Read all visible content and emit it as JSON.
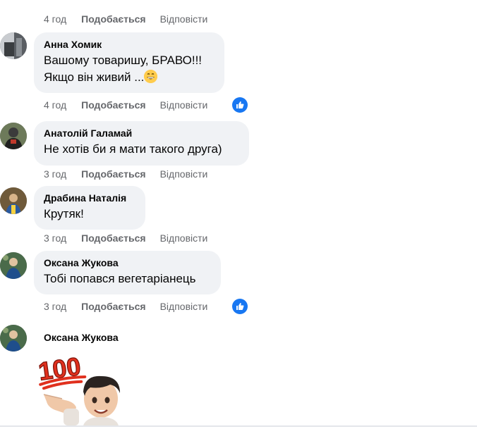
{
  "top_meta": {
    "time": "4 год",
    "like": "Подобається",
    "reply": "Відповісти"
  },
  "comments": [
    {
      "author": "Анна Хомик",
      "lines": [
        "Вашому товаришу, БРАВО!!!",
        "Якщо він живий ..."
      ],
      "emoji": "grinning-face-emoji",
      "time": "4 год",
      "like": "Подобається",
      "reply": "Відповісти",
      "reaction": "like"
    },
    {
      "author": "Анатолій Галамай",
      "lines": [
        "Не хотів би я мати такого друга)"
      ],
      "time": "3 год",
      "like": "Подобається",
      "reply": "Відповісти"
    },
    {
      "author": "Драбина Наталія",
      "lines": [
        "Крутяк!"
      ],
      "time": "3 год",
      "like": "Подобається",
      "reply": "Відповісти"
    },
    {
      "author": "Оксана Жукова",
      "lines": [
        "Тобі попався вегетаріанець"
      ],
      "time": "3 год",
      "like": "Подобається",
      "reply": "Відповісти",
      "reaction": "like"
    },
    {
      "author": "Оксана Жукова",
      "sticker": {
        "label": "100",
        "icon": "hundred-points-sticker"
      }
    }
  ],
  "colors": {
    "bubble": "#f0f2f5",
    "meta_text": "#65676b",
    "like_reaction": "#1877f2",
    "sticker_red": "#e0301e"
  }
}
